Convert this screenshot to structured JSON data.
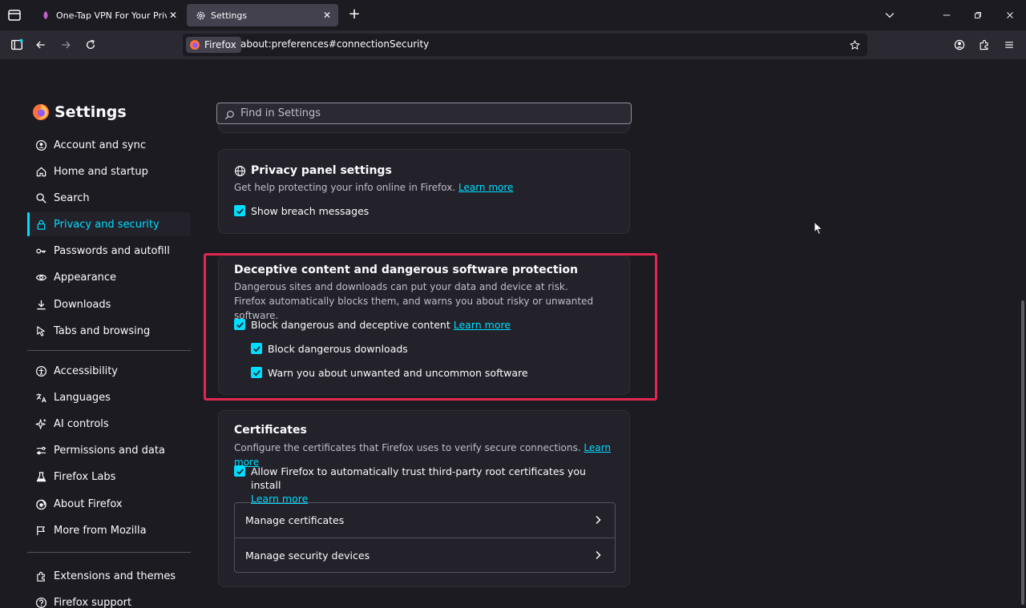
{
  "browser": {
    "tabs": [
      {
        "title": "One-Tap VPN For Your Privacy &",
        "active": false
      },
      {
        "title": "Settings",
        "active": true
      }
    ],
    "identity_label": "Firefox",
    "url": "about:preferences#connectionSecurity"
  },
  "sidebar": {
    "title": "Settings",
    "items": [
      {
        "label": "Account and sync",
        "icon": "account-icon"
      },
      {
        "label": "Home and startup",
        "icon": "home-icon"
      },
      {
        "label": "Search",
        "icon": "search-icon"
      },
      {
        "label": "Privacy and security",
        "icon": "lock-icon",
        "selected": true
      },
      {
        "label": "Passwords and autofill",
        "icon": "key-icon"
      },
      {
        "label": "Appearance",
        "icon": "eye-icon"
      },
      {
        "label": "Downloads",
        "icon": "download-icon"
      },
      {
        "label": "Tabs and browsing",
        "icon": "pointer-icon"
      }
    ],
    "items2": [
      {
        "label": "Accessibility",
        "icon": "accessibility-icon"
      },
      {
        "label": "Languages",
        "icon": "translate-icon"
      },
      {
        "label": "AI controls",
        "icon": "sparkle-icon"
      },
      {
        "label": "Permissions and data",
        "icon": "permissions-icon"
      },
      {
        "label": "Firefox Labs",
        "icon": "flask-icon"
      },
      {
        "label": "About Firefox",
        "icon": "firefox-icon"
      },
      {
        "label": "More from Mozilla",
        "icon": "mozilla-icon"
      }
    ],
    "items3": [
      {
        "label": "Extensions and themes",
        "icon": "puzzle-icon"
      },
      {
        "label": "Firefox support",
        "icon": "help-icon"
      }
    ]
  },
  "search": {
    "placeholder": "Find in Settings"
  },
  "privacy_panel": {
    "title": "Privacy panel settings",
    "desc": "Get help protecting your info online in Firefox.",
    "learn_more": "Learn more",
    "checkbox": "Show breach messages"
  },
  "deceptive": {
    "title": "Deceptive content and dangerous software protection",
    "desc": "Dangerous sites and downloads can put your data and device at risk. Firefox automatically blocks them, and warns you about risky or unwanted software.",
    "block_content": "Block dangerous and deceptive content",
    "learn_more": "Learn more",
    "block_downloads": "Block dangerous downloads",
    "warn_unwanted": "Warn you about unwanted and uncommon software"
  },
  "certificates": {
    "title": "Certificates",
    "desc": "Configure the certificates that Firefox uses to verify secure connections.",
    "learn_more": "Learn more",
    "allow_trust": "Allow Firefox to automatically trust third-party root certificates you install",
    "allow_learn_more": "Learn more",
    "manage_certs": "Manage certificates",
    "manage_devices": "Manage security devices"
  },
  "colors": {
    "accent": "#00ddff",
    "highlight": "#e22850",
    "background": "#1c1b22"
  }
}
